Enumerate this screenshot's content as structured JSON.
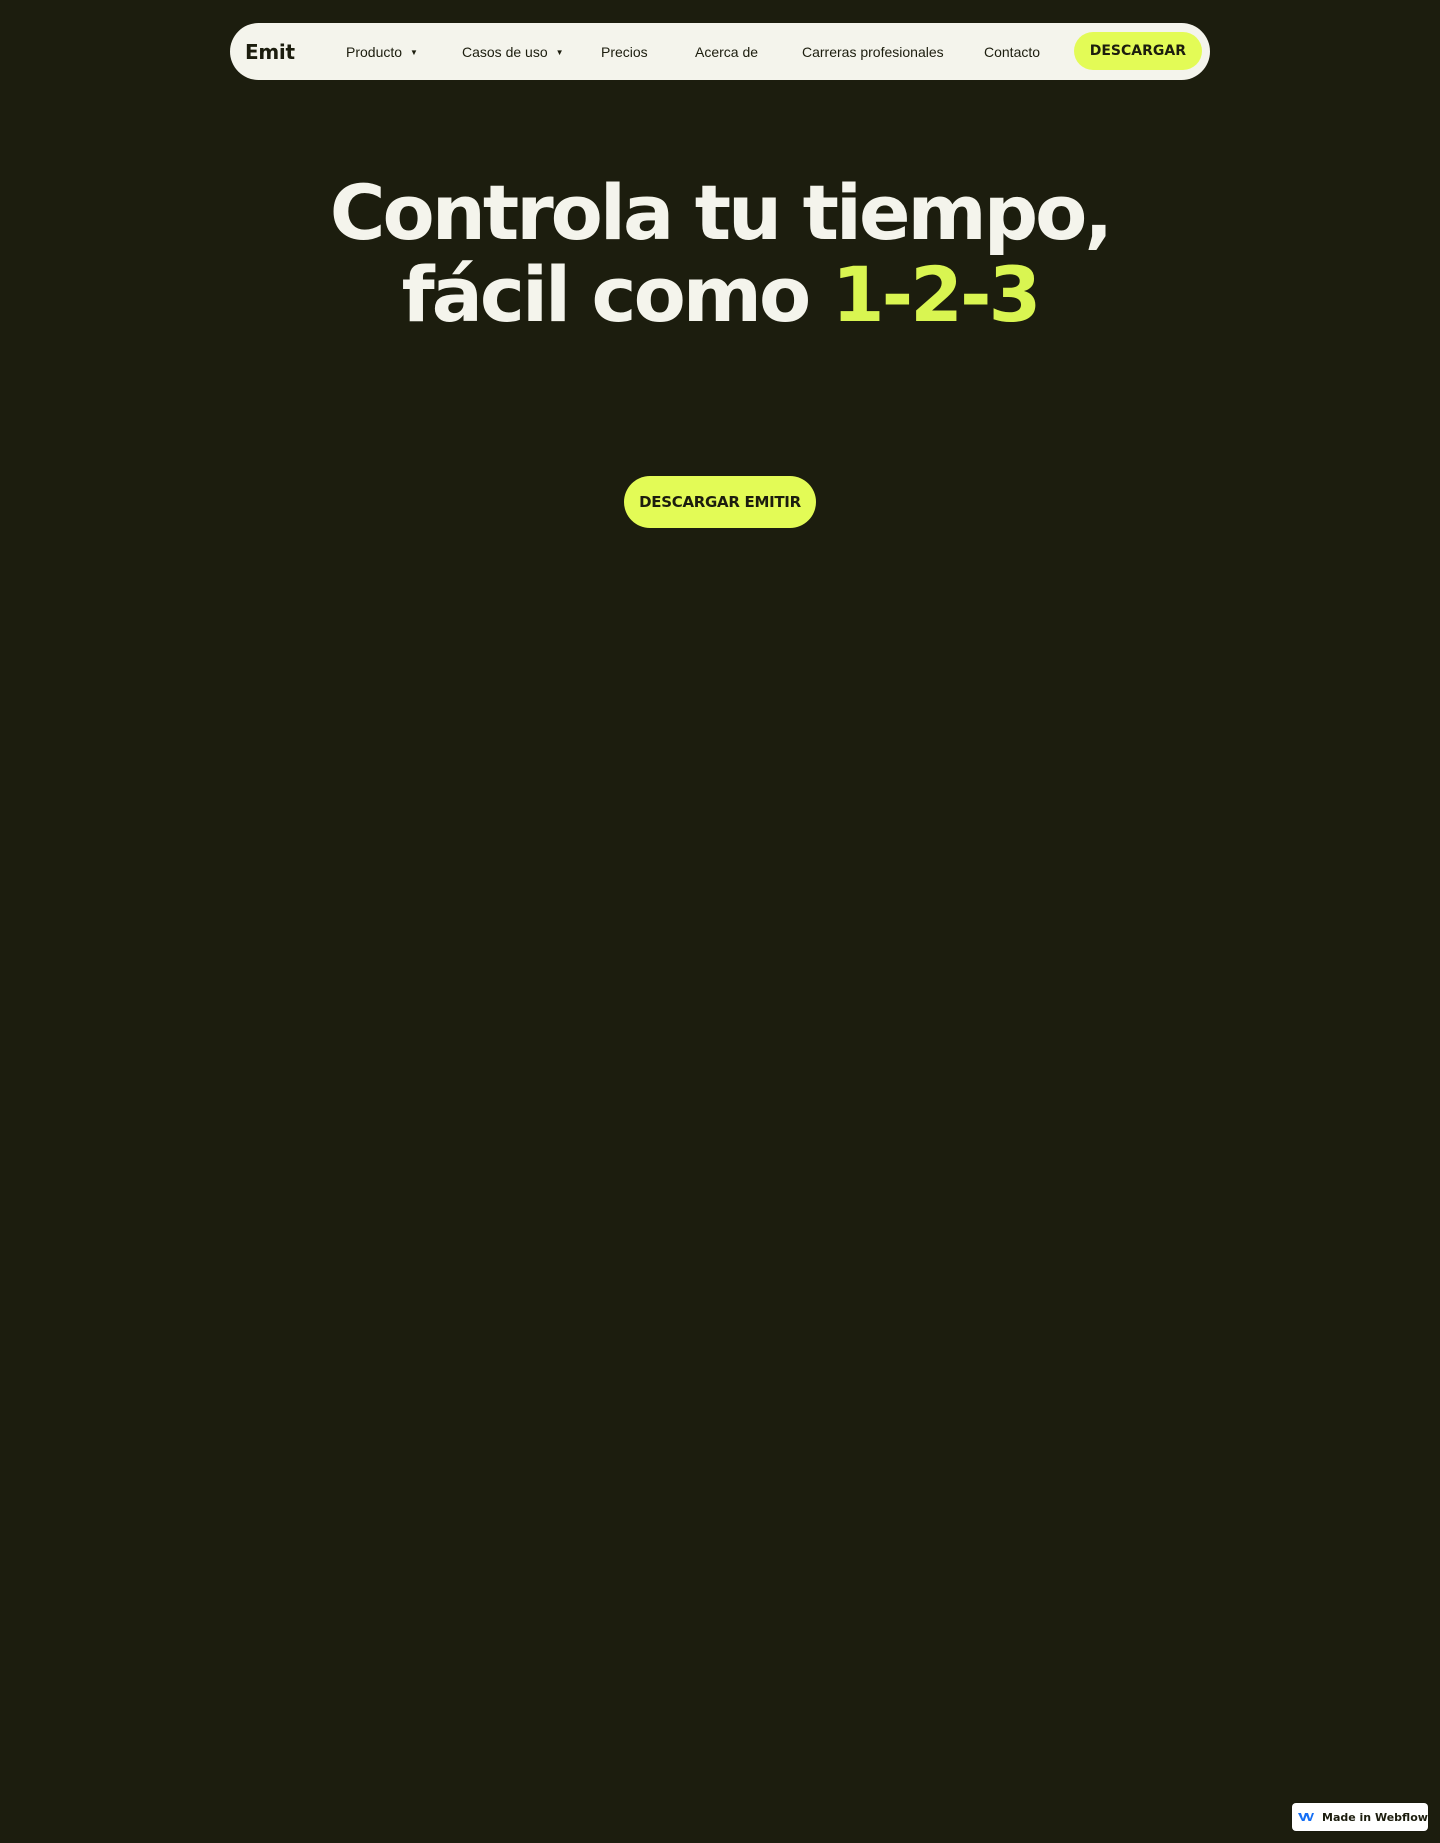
{
  "nav": {
    "logo": "Emit",
    "items": [
      {
        "label": "Producto",
        "icon": "caret-down-icon"
      },
      {
        "label": "Casos de uso",
        "icon": "caret-down-icon"
      },
      {
        "label": "Precios"
      },
      {
        "label": "Acerca de"
      },
      {
        "label": "Carreras profesionales"
      },
      {
        "label": "Contacto"
      }
    ],
    "cta": "DESCARGAR"
  },
  "hero": {
    "line1": "Controla tu tiempo,",
    "line2_prefix": "fácil como",
    "line2_accent": "1-2-3",
    "cta": "DESCARGAR EMITIR"
  },
  "badge": {
    "label": "Made in Webflow",
    "icon": "webflow-logo-icon"
  },
  "colors": {
    "background": "#1c1d0e",
    "accent": "#e3fb56",
    "text_light": "#f4f4ec",
    "webflow_blue": "#146ef5"
  }
}
